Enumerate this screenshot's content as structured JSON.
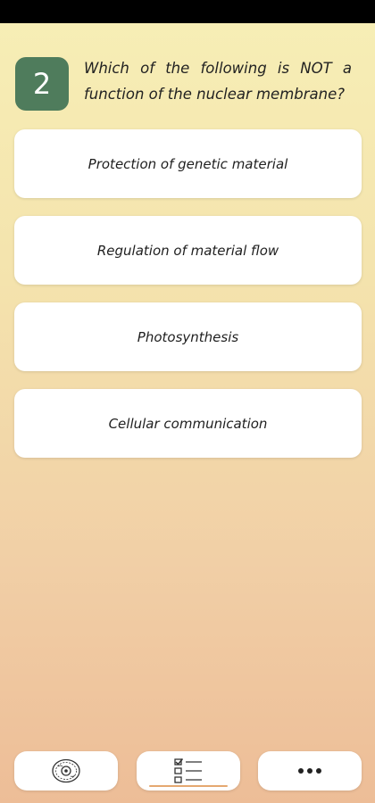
{
  "question": {
    "number": "2",
    "text": "Which of the following is NOT a function of the nuclear membrane?"
  },
  "answers": [
    {
      "label": "Protection of genetic material"
    },
    {
      "label": "Regulation of material flow"
    },
    {
      "label": "Photosynthesis"
    },
    {
      "label": "Cellular communication"
    }
  ],
  "bottom_nav": {
    "items": [
      {
        "icon": "cell-icon"
      },
      {
        "icon": "checklist-icon",
        "active": true
      },
      {
        "icon": "more-dots-icon"
      }
    ],
    "active_color": "#e5a870"
  },
  "colors": {
    "accent": "#4f7c5c",
    "background_top": "#f7efb6",
    "background_bottom": "#edbd97"
  }
}
